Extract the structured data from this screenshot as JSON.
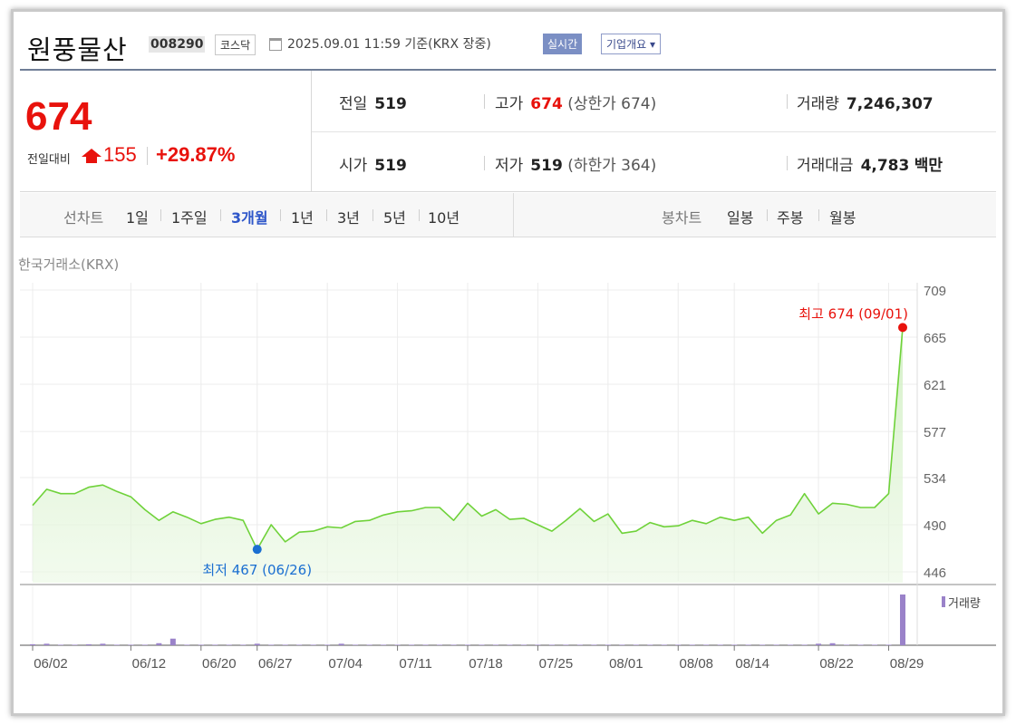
{
  "header": {
    "name": "원풍물산",
    "code": "008290",
    "market": "코스닥",
    "datetime": "2025.09.01 11:59  기준(KRX 장중)",
    "realtime_button": "실시간",
    "company_button": "기업개요 ▾"
  },
  "price": {
    "current": "674",
    "change_label": "전일대비",
    "change_value": "155",
    "change_pct": "+29.87%",
    "colors": {
      "up": "#e8120c"
    }
  },
  "stats": {
    "prev": {
      "label": "전일",
      "value": "519"
    },
    "high": {
      "label": "고가",
      "value": "674",
      "sub": "(상한가 674)"
    },
    "volume": {
      "label": "거래량",
      "value": "7,246,307"
    },
    "open": {
      "label": "시가",
      "value": "519"
    },
    "low": {
      "label": "저가",
      "value": "519",
      "sub": "(하한가 364)"
    },
    "amount": {
      "label": "거래대금",
      "value": "4,783",
      "unit": "백만"
    }
  },
  "tabs": {
    "line_label": "선차트",
    "line_items": [
      "1일",
      "1주일",
      "3개월",
      "1년",
      "3년",
      "5년",
      "10년"
    ],
    "active": "3개월",
    "candle_label": "봉차트",
    "candle_items": [
      "일봉",
      "주봉",
      "월봉"
    ]
  },
  "source": "한국거래소(KRX)",
  "chart_data": {
    "type": "area",
    "y_ticks": [
      709,
      665,
      621,
      577,
      534,
      490,
      446
    ],
    "ylim": [
      446,
      709
    ],
    "x_tick_labels": [
      "06/02",
      "06/12",
      "06/20",
      "06/27",
      "07/04",
      "07/11",
      "07/18",
      "07/25",
      "08/01",
      "08/08",
      "08/14",
      "08/22",
      "08/29"
    ],
    "series": [
      {
        "values": [
          508,
          523,
          519,
          519,
          525,
          527,
          521,
          516,
          504,
          494,
          502,
          497,
          491,
          495,
          497,
          494,
          467,
          490,
          474,
          483,
          484,
          488,
          487,
          493,
          494,
          499,
          502,
          503,
          506,
          506,
          494,
          510,
          498,
          504,
          495,
          496,
          490,
          484,
          494,
          505,
          493,
          500,
          482,
          484,
          492,
          488,
          489,
          494,
          491,
          497,
          494,
          497,
          482,
          494,
          499,
          519,
          500,
          510,
          509,
          506,
          506,
          519,
          674
        ],
        "color": "#6fd23a"
      }
    ],
    "volume": {
      "label": "거래량",
      "values": [
        0.02,
        0.03,
        0.01,
        0.01,
        0.02,
        0.03,
        0.01,
        0.01,
        0.01,
        0.04,
        0.13,
        0.01,
        0.01,
        0.01,
        0.01,
        0.01,
        0.03,
        0.01,
        0.01,
        0.01,
        0.01,
        0.01,
        0.03,
        0.01,
        0.01,
        0.01,
        0.01,
        0.01,
        0.01,
        0.01,
        0.01,
        0.01,
        0.01,
        0.01,
        0.01,
        0.01,
        0.01,
        0.01,
        0.01,
        0.01,
        0.01,
        0.01,
        0.01,
        0.01,
        0.01,
        0.01,
        0.01,
        0.01,
        0.01,
        0.01,
        0.01,
        0.01,
        0.01,
        0.01,
        0.01,
        0.01,
        0.03,
        0.04,
        0.01,
        0.01,
        0.01,
        0.01,
        1.0
      ],
      "color": "#9a82c9"
    },
    "max_annotation": {
      "text": "최고 674 (09/01)",
      "color": "#e8120c"
    },
    "min_annotation": {
      "text": "최저 467 (06/26)",
      "color": "#1b6fd1"
    },
    "grid": true
  }
}
